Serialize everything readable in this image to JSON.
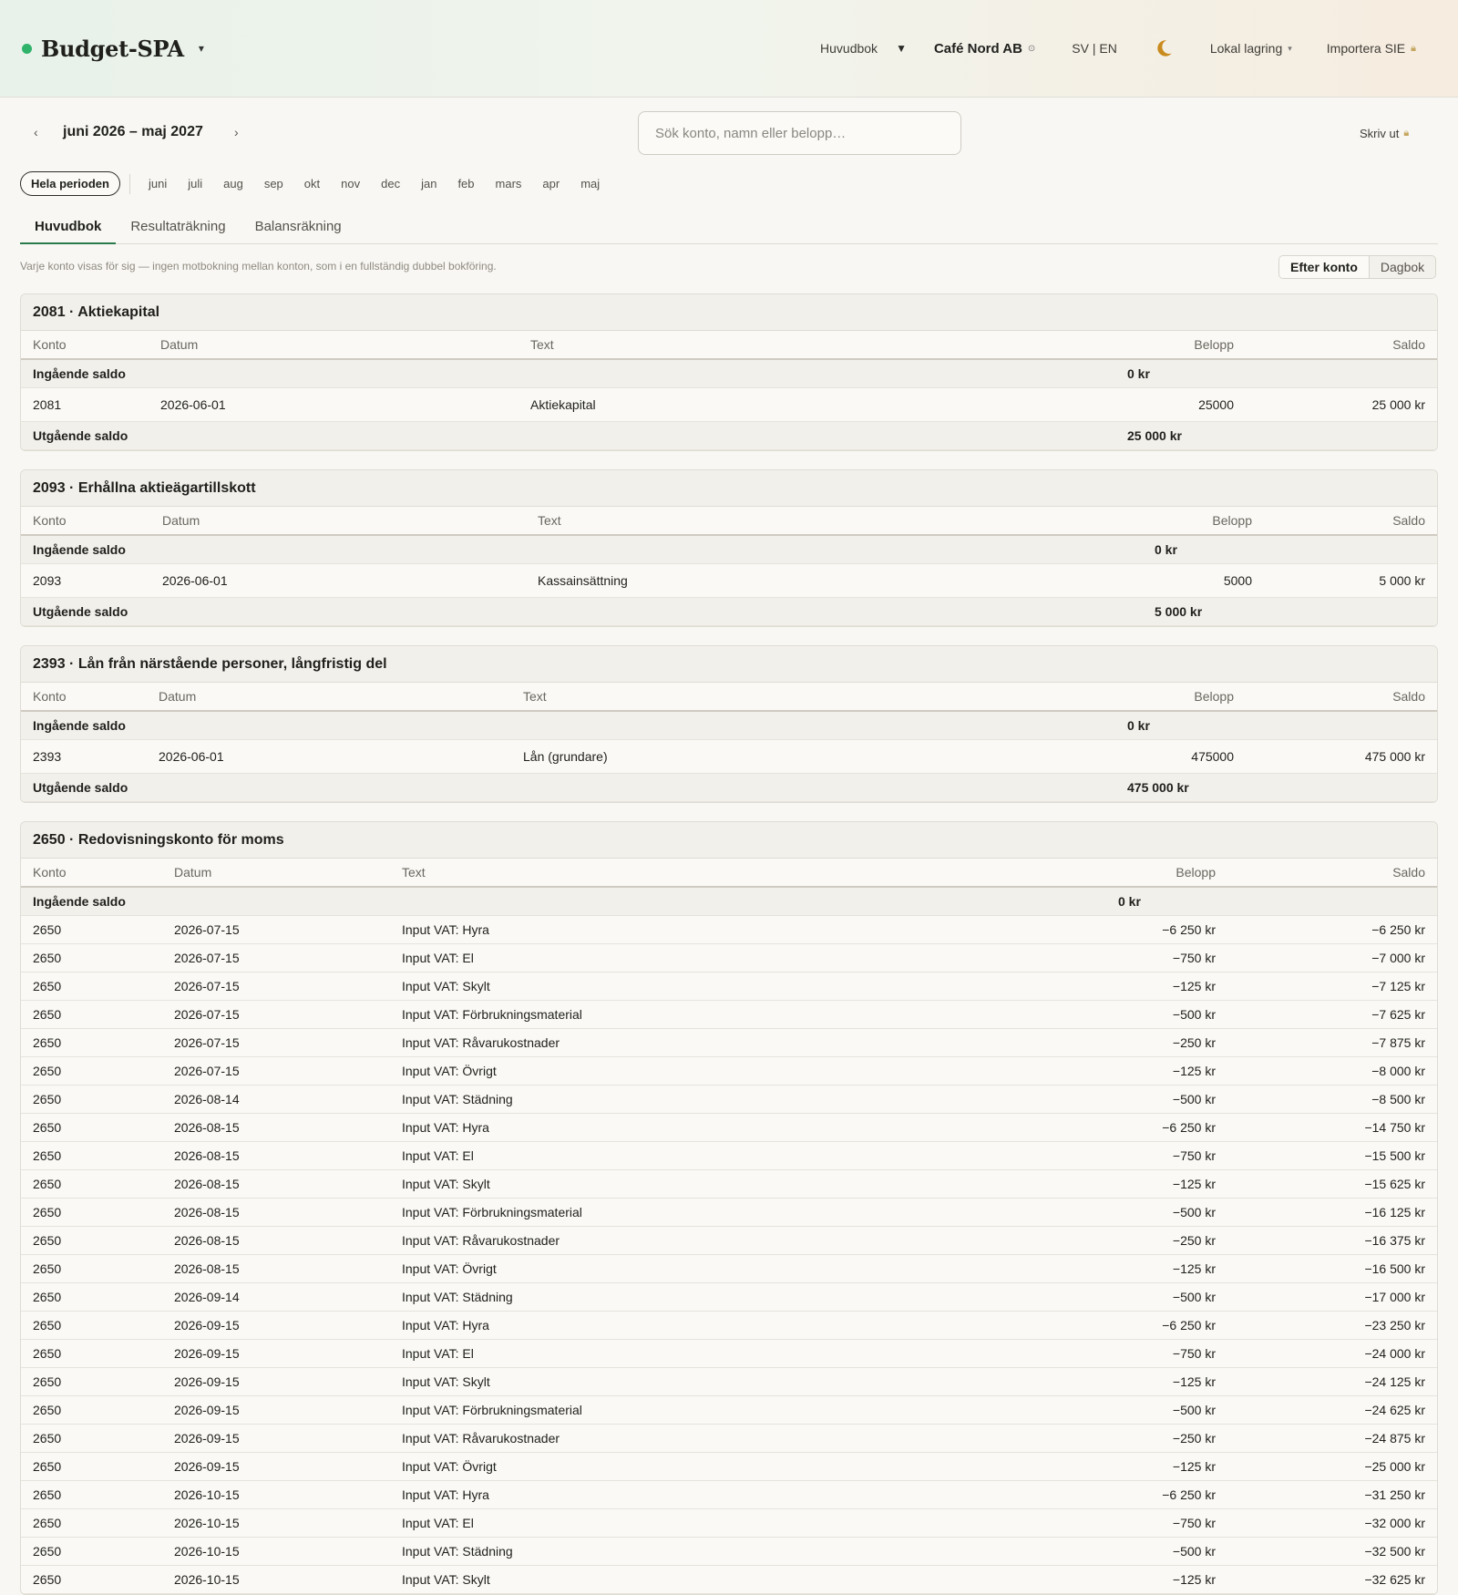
{
  "header": {
    "title": "Budget-SPA",
    "view": "Huvudbok",
    "company": "Café Nord AB",
    "lang": "SV | EN",
    "storage": "Lokal lagring",
    "import": "Importera SIE"
  },
  "toolbar": {
    "period": "juni 2026 – maj 2027",
    "search_placeholder": "Sök konto, namn eller belopp…",
    "print": "Skriv ut",
    "all_period": "Hela perioden",
    "months": [
      "juni",
      "juli",
      "aug",
      "sep",
      "okt",
      "nov",
      "dec",
      "jan",
      "feb",
      "mars",
      "apr",
      "maj"
    ]
  },
  "tabs": [
    "Huvudbok",
    "Resultaträkning",
    "Balansräkning"
  ],
  "note": "Varje konto visas för sig — ingen motbokning mellan konton, som i en fullständig dubbel bokföring.",
  "view_toggle": [
    "Efter konto",
    "Dagbok"
  ],
  "columns": {
    "konto": "Konto",
    "datum": "Datum",
    "text": "Text",
    "belopp": "Belopp",
    "saldo": "Saldo"
  },
  "opening_label": "Ingående saldo",
  "closing_label": "Utgående saldo",
  "accounts": [
    {
      "title": "2081 · Aktiekapital",
      "opening": "0 kr",
      "rows": [
        [
          "2081",
          "2026-06-01",
          "Aktiekapital",
          "25000",
          "25 000 kr"
        ]
      ],
      "closing": "25 000 kr"
    },
    {
      "title": "2093 · Erhållna aktieägartillskott",
      "opening": "0 kr",
      "rows": [
        [
          "2093",
          "2026-06-01",
          "Kassainsättning",
          "5000",
          "5 000 kr"
        ]
      ],
      "closing": "5 000 kr"
    },
    {
      "title": "2393 · Lån från närstående personer, långfristig del",
      "opening": "0 kr",
      "rows": [
        [
          "2393",
          "2026-06-01",
          "Lån (grundare)",
          "475000",
          "475 000 kr"
        ]
      ],
      "closing": "475 000 kr"
    },
    {
      "title": "2650 · Redovisningskonto för moms",
      "opening": "0 kr",
      "rows": [
        [
          "2650",
          "2026-07-15",
          "Input VAT: Hyra",
          "−6 250 kr",
          "−6 250 kr"
        ],
        [
          "2650",
          "2026-07-15",
          "Input VAT: El",
          "−750 kr",
          "−7 000 kr"
        ],
        [
          "2650",
          "2026-07-15",
          "Input VAT: Skylt",
          "−125 kr",
          "−7 125 kr"
        ],
        [
          "2650",
          "2026-07-15",
          "Input VAT: Förbrukningsmaterial",
          "−500 kr",
          "−7 625 kr"
        ],
        [
          "2650",
          "2026-07-15",
          "Input VAT: Råvarukostnader",
          "−250 kr",
          "−7 875 kr"
        ],
        [
          "2650",
          "2026-07-15",
          "Input VAT: Övrigt",
          "−125 kr",
          "−8 000 kr"
        ],
        [
          "2650",
          "2026-08-14",
          "Input VAT: Städning",
          "−500 kr",
          "−8 500 kr"
        ],
        [
          "2650",
          "2026-08-15",
          "Input VAT: Hyra",
          "−6 250 kr",
          "−14 750 kr"
        ],
        [
          "2650",
          "2026-08-15",
          "Input VAT: El",
          "−750 kr",
          "−15 500 kr"
        ],
        [
          "2650",
          "2026-08-15",
          "Input VAT: Skylt",
          "−125 kr",
          "−15 625 kr"
        ],
        [
          "2650",
          "2026-08-15",
          "Input VAT: Förbrukningsmaterial",
          "−500 kr",
          "−16 125 kr"
        ],
        [
          "2650",
          "2026-08-15",
          "Input VAT: Råvarukostnader",
          "−250 kr",
          "−16 375 kr"
        ],
        [
          "2650",
          "2026-08-15",
          "Input VAT: Övrigt",
          "−125 kr",
          "−16 500 kr"
        ],
        [
          "2650",
          "2026-09-14",
          "Input VAT: Städning",
          "−500 kr",
          "−17 000 kr"
        ],
        [
          "2650",
          "2026-09-15",
          "Input VAT: Hyra",
          "−6 250 kr",
          "−23 250 kr"
        ],
        [
          "2650",
          "2026-09-15",
          "Input VAT: El",
          "−750 kr",
          "−24 000 kr"
        ],
        [
          "2650",
          "2026-09-15",
          "Input VAT: Skylt",
          "−125 kr",
          "−24 125 kr"
        ],
        [
          "2650",
          "2026-09-15",
          "Input VAT: Förbrukningsmaterial",
          "−500 kr",
          "−24 625 kr"
        ],
        [
          "2650",
          "2026-09-15",
          "Input VAT: Råvarukostnader",
          "−250 kr",
          "−24 875 kr"
        ],
        [
          "2650",
          "2026-09-15",
          "Input VAT: Övrigt",
          "−125 kr",
          "−25 000 kr"
        ],
        [
          "2650",
          "2026-10-15",
          "Input VAT: Hyra",
          "−6 250 kr",
          "−31 250 kr"
        ],
        [
          "2650",
          "2026-10-15",
          "Input VAT: El",
          "−750 kr",
          "−32 000 kr"
        ],
        [
          "2650",
          "2026-10-15",
          "Input VAT: Städning",
          "−500 kr",
          "−32 500 kr"
        ],
        [
          "2650",
          "2026-10-15",
          "Input VAT: Skylt",
          "−125 kr",
          "−32 625 kr"
        ]
      ]
    }
  ],
  "colors": {
    "accent": "#2b7a4b",
    "brand_dot": "#2fb36b",
    "moon": "#c98b1e"
  }
}
